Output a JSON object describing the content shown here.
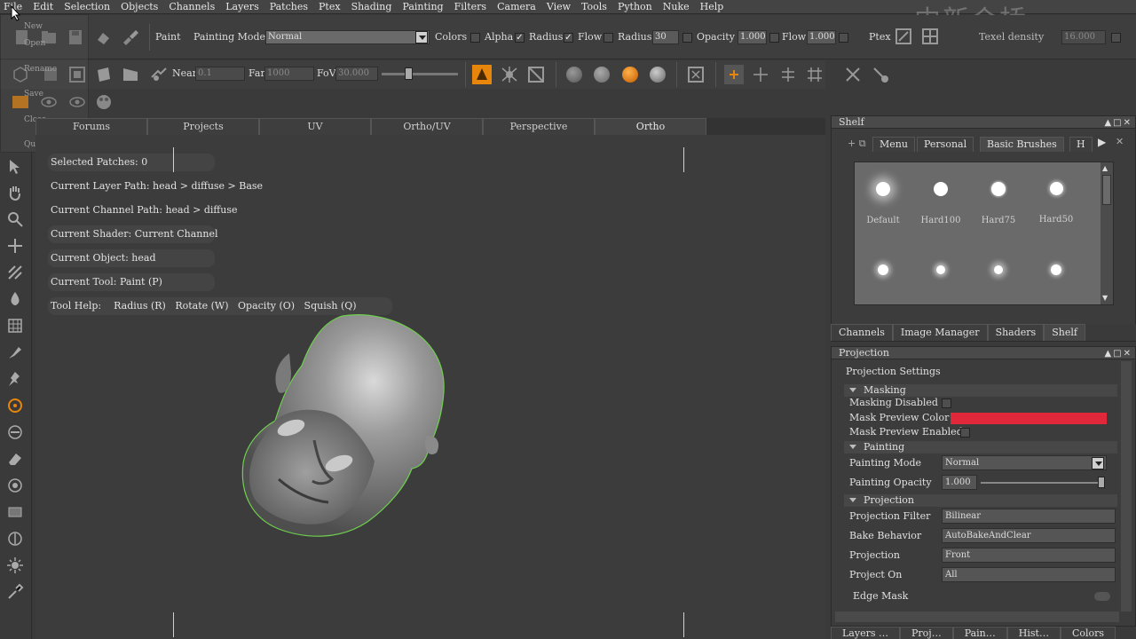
{
  "menu": [
    "File",
    "Edit",
    "Selection",
    "Objects",
    "Channels",
    "Layers",
    "Patches",
    "Ptex",
    "Shading",
    "Painting",
    "Filters",
    "Camera",
    "View",
    "Tools",
    "Python",
    "Nuke",
    "Help"
  ],
  "watermark": "中新会桥",
  "file_menu": [
    "New",
    "Open",
    "Rename",
    "Save",
    "Close",
    "Quit"
  ],
  "toolbar": {
    "paint_label": "Paint",
    "painting_mode_label": "Painting Mode",
    "painting_mode_value": "Normal",
    "colors_label": "Colors",
    "alpha_label": "Alpha",
    "radius_label": "Radius",
    "flow_label": "Flow",
    "radius2_label": "Radius",
    "radius_value": "30",
    "opacity_label": "Opacity",
    "opacity_value": "1.000",
    "flow2_label": "Flow",
    "flow_value": "1.000",
    "ptex_label": "Ptex",
    "texel_density_label": "Texel density",
    "texel_density_value": "16.000"
  },
  "camera": {
    "near_label": "Near",
    "near_value": "0.1",
    "far_label": "Far",
    "far_value": "1000",
    "fov_label": "FoV",
    "fov_value": "30.000"
  },
  "viewport_tabs": [
    "Forums",
    "Projects",
    "UV",
    "Ortho/UV",
    "Perspective",
    "Ortho"
  ],
  "info": {
    "selected_patches": "Selected Patches: 0",
    "layer_path": "Current Layer Path: head > diffuse > Base",
    "channel_path": "Current Channel Path: head > diffuse",
    "shader": "Current Shader: Current Channel",
    "object": "Current Object: head",
    "tool": "Current Tool: Paint (P)",
    "tool_help": "Tool Help:    Radius (R)   Rotate (W)   Opacity (O)   Squish (Q)"
  },
  "shelf": {
    "title": "Shelf",
    "tabs": [
      "Menu",
      "Personal",
      "Basic Brushes",
      "H"
    ],
    "brushes": [
      {
        "name": "Default",
        "soft": true
      },
      {
        "name": "Hard100",
        "soft": false
      },
      {
        "name": "Hard75",
        "soft": false
      },
      {
        "name": "Hard50",
        "soft": false
      }
    ]
  },
  "panel_tabs": [
    "Channels",
    "Image Manager",
    "Shaders",
    "Shelf"
  ],
  "projection": {
    "title": "Projection",
    "settings": "Projection Settings",
    "masking_section": "Masking",
    "masking_disabled": "Masking Disabled",
    "mask_preview_color_label": "Mask Preview Color",
    "mask_preview_color": "#e0283a",
    "mask_preview_enabled": "Mask Preview Enabled",
    "painting_section": "Painting",
    "painting_mode_label": "Painting Mode",
    "painting_mode_value": "Normal",
    "painting_opacity_label": "Painting Opacity",
    "painting_opacity_value": "1.000",
    "projection_section": "Projection",
    "projection_filter_label": "Projection Filter",
    "projection_filter_value": "Bilinear",
    "bake_behavior_label": "Bake Behavior",
    "bake_behavior_value": "AutoBakeAndClear",
    "projection_label": "Projection",
    "projection_value": "Front",
    "project_on_label": "Project On",
    "project_on_value": "All",
    "edge_mask": "Edge Mask"
  },
  "bottom_tabs": [
    "Layers …",
    "Proj…",
    "Pain…",
    "Hist…",
    "Colors"
  ],
  "colors": {
    "accent": "#e8860c",
    "selection_outline": "#6fcf4e"
  }
}
